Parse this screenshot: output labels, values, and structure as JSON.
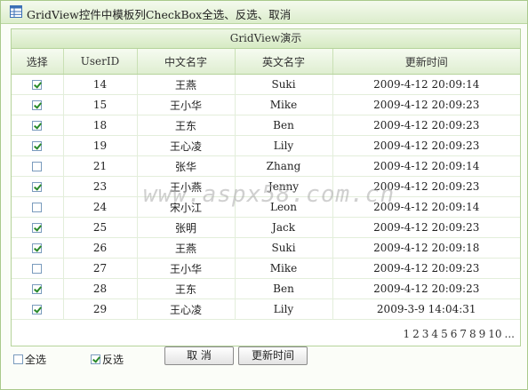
{
  "window": {
    "title": "GridView控件中模板列CheckBox全选、反选、取消"
  },
  "grid": {
    "caption": "GridView演示",
    "columns": [
      "选择",
      "UserID",
      "中文名字",
      "英文名字",
      "更新时间"
    ],
    "rows": [
      {
        "checked": true,
        "id": "14",
        "cn": "王燕",
        "en": "Suki",
        "time": "2009-4-12 20:09:14"
      },
      {
        "checked": true,
        "id": "15",
        "cn": "王小华",
        "en": "Mike",
        "time": "2009-4-12 20:09:23"
      },
      {
        "checked": true,
        "id": "18",
        "cn": "王东",
        "en": "Ben",
        "time": "2009-4-12 20:09:23"
      },
      {
        "checked": true,
        "id": "19",
        "cn": "王心凌",
        "en": "Lily",
        "time": "2009-4-12 20:09:23"
      },
      {
        "checked": false,
        "id": "21",
        "cn": "张华",
        "en": "Zhang",
        "time": "2009-4-12 20:09:14"
      },
      {
        "checked": true,
        "id": "23",
        "cn": "王小燕",
        "en": "Jenny",
        "time": "2009-4-12 20:09:23"
      },
      {
        "checked": false,
        "id": "24",
        "cn": "宋小江",
        "en": "Leon",
        "time": "2009-4-12 20:09:14"
      },
      {
        "checked": true,
        "id": "25",
        "cn": "张明",
        "en": "Jack",
        "time": "2009-4-12 20:09:23"
      },
      {
        "checked": true,
        "id": "26",
        "cn": "王燕",
        "en": "Suki",
        "time": "2009-4-12 20:09:18"
      },
      {
        "checked": false,
        "id": "27",
        "cn": "王小华",
        "en": "Mike",
        "time": "2009-4-12 20:09:23"
      },
      {
        "checked": true,
        "id": "28",
        "cn": "王东",
        "en": "Ben",
        "time": "2009-4-12 20:09:23"
      },
      {
        "checked": true,
        "id": "29",
        "cn": "王心凌",
        "en": "Lily",
        "time": "2009-3-9 14:04:31"
      }
    ],
    "pager": [
      "1",
      "2",
      "3",
      "4",
      "5",
      "6",
      "7",
      "8",
      "9",
      "10",
      "..."
    ]
  },
  "watermark": "www.aspx58.com.cn",
  "footer": {
    "select_all_label": "全选",
    "select_all_checked": false,
    "invert_label": "反选",
    "invert_checked": true,
    "cancel_button": "取  消",
    "update_button": "更新时间"
  },
  "colors": {
    "border": "#a9c98c",
    "header_bg": "#dfeed1",
    "check": "#2a8a2a"
  }
}
